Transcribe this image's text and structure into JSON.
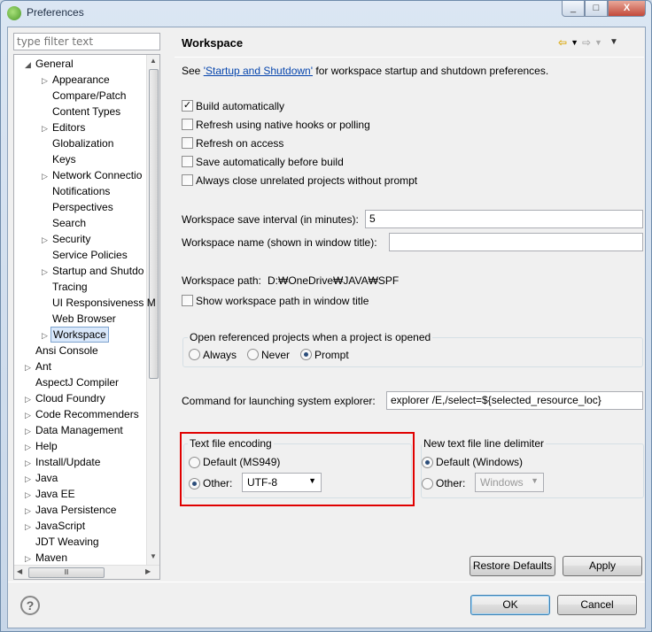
{
  "window": {
    "title": "Preferences",
    "min": "_",
    "max": "□",
    "close": "X"
  },
  "filter": {
    "placeholder": "type filter text"
  },
  "tree": [
    {
      "label": "General",
      "level": 0,
      "expander": "◢"
    },
    {
      "label": "Appearance",
      "level": 1,
      "expander": "▷"
    },
    {
      "label": "Compare/Patch",
      "level": 1,
      "expander": ""
    },
    {
      "label": "Content Types",
      "level": 1,
      "expander": ""
    },
    {
      "label": "Editors",
      "level": 1,
      "expander": "▷"
    },
    {
      "label": "Globalization",
      "level": 1,
      "expander": ""
    },
    {
      "label": "Keys",
      "level": 1,
      "expander": ""
    },
    {
      "label": "Network Connectio",
      "level": 1,
      "expander": "▷"
    },
    {
      "label": "Notifications",
      "level": 1,
      "expander": ""
    },
    {
      "label": "Perspectives",
      "level": 1,
      "expander": ""
    },
    {
      "label": "Search",
      "level": 1,
      "expander": ""
    },
    {
      "label": "Security",
      "level": 1,
      "expander": "▷"
    },
    {
      "label": "Service Policies",
      "level": 1,
      "expander": ""
    },
    {
      "label": "Startup and Shutdo",
      "level": 1,
      "expander": "▷"
    },
    {
      "label": "Tracing",
      "level": 1,
      "expander": ""
    },
    {
      "label": "UI Responsiveness M",
      "level": 1,
      "expander": ""
    },
    {
      "label": "Web Browser",
      "level": 1,
      "expander": ""
    },
    {
      "label": "Workspace",
      "level": 1,
      "expander": "▷",
      "selected": true
    },
    {
      "label": "Ansi Console",
      "level": 0,
      "expander": ""
    },
    {
      "label": "Ant",
      "level": 0,
      "expander": "▷"
    },
    {
      "label": "AspectJ Compiler",
      "level": 0,
      "expander": ""
    },
    {
      "label": "Cloud Foundry",
      "level": 0,
      "expander": "▷"
    },
    {
      "label": "Code Recommenders",
      "level": 0,
      "expander": "▷"
    },
    {
      "label": "Data Management",
      "level": 0,
      "expander": "▷"
    },
    {
      "label": "Help",
      "level": 0,
      "expander": "▷"
    },
    {
      "label": "Install/Update",
      "level": 0,
      "expander": "▷"
    },
    {
      "label": "Java",
      "level": 0,
      "expander": "▷"
    },
    {
      "label": "Java EE",
      "level": 0,
      "expander": "▷"
    },
    {
      "label": "Java Persistence",
      "level": 0,
      "expander": "▷"
    },
    {
      "label": "JavaScript",
      "level": 0,
      "expander": "▷"
    },
    {
      "label": "JDT Weaving",
      "level": 0,
      "expander": ""
    },
    {
      "label": "Maven",
      "level": 0,
      "expander": "▷"
    }
  ],
  "page": {
    "title": "Workspace",
    "intro_prefix": "See ",
    "intro_link": "'Startup and Shutdown'",
    "intro_suffix": " for workspace startup and shutdown preferences.",
    "checkboxes": [
      {
        "label": "Build automatically",
        "checked": true
      },
      {
        "label": "Refresh using native hooks or polling",
        "checked": false
      },
      {
        "label": "Refresh on access",
        "checked": false
      },
      {
        "label": "Save automatically before build",
        "checked": false
      },
      {
        "label": "Always close unrelated projects without prompt",
        "checked": false
      }
    ],
    "save_interval_label": "Workspace save interval (in minutes):",
    "save_interval_value": "5",
    "ws_name_label": "Workspace name (shown in window title):",
    "ws_name_value": "",
    "ws_path_label": "Workspace path:",
    "ws_path_value": "D:₩OneDrive₩JAVA₩SPF",
    "show_path_label": "Show workspace path in window title",
    "open_ref_title": "Open referenced projects when a project is opened",
    "open_ref_options": [
      "Always",
      "Never",
      "Prompt"
    ],
    "open_ref_selected": "Prompt",
    "explorer_label": "Command for launching system explorer:",
    "explorer_value": "explorer /E,/select=${selected_resource_loc}",
    "encoding_title": "Text file encoding",
    "encoding_default": "Default (MS949)",
    "encoding_other": "Other:",
    "encoding_value": "UTF-8",
    "delim_title": "New text file line delimiter",
    "delim_default": "Default (Windows)",
    "delim_other": "Other:",
    "delim_value": "Windows",
    "restore_defaults": "Restore Defaults",
    "apply": "Apply"
  },
  "footer": {
    "help": "?",
    "ok": "OK",
    "cancel": "Cancel"
  },
  "colors": {
    "highlight": "#e00000",
    "link": "#0645ad",
    "selection": "#d9e8fb"
  }
}
